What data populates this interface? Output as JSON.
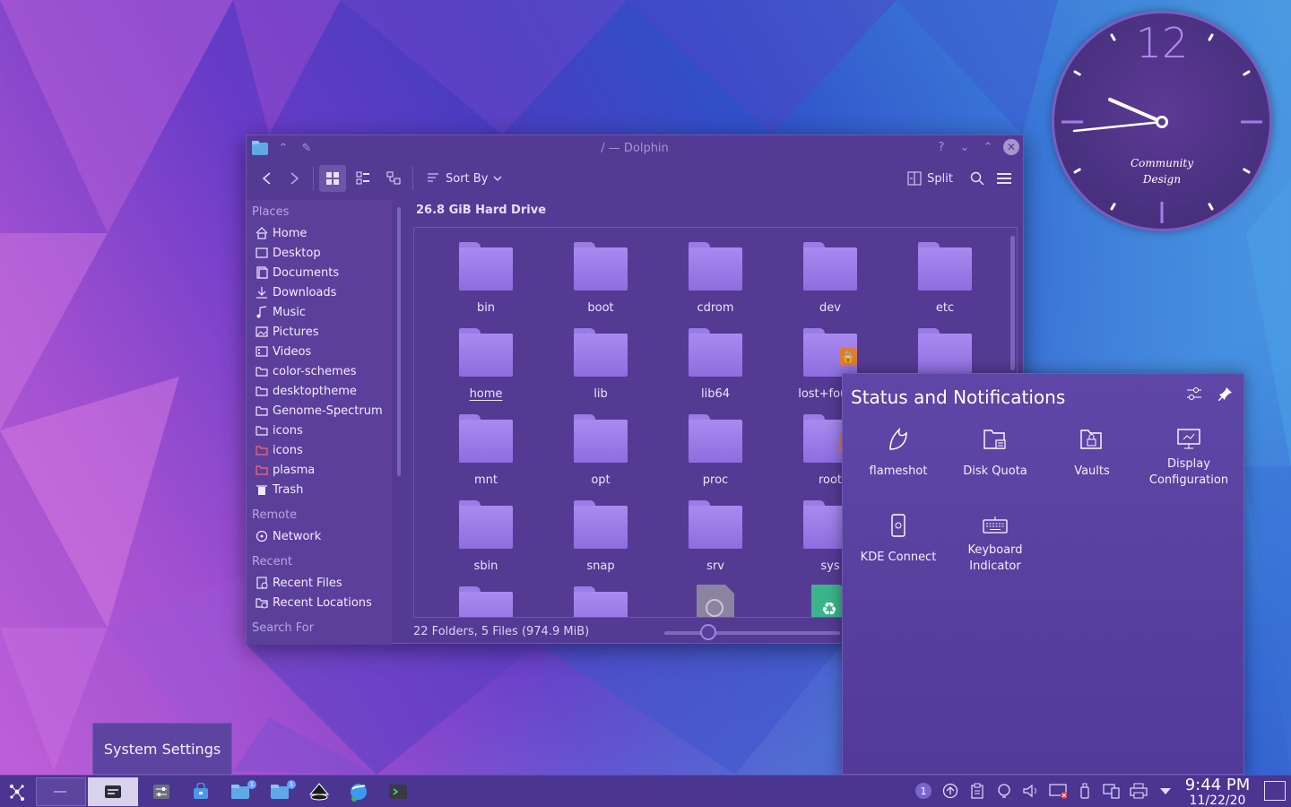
{
  "clock_widget": {
    "twelve": "12",
    "brand_line1": "Community",
    "brand_line2": "Design"
  },
  "dolphin": {
    "title": "/ — Dolphin",
    "toolbar": {
      "sort_by": "Sort By",
      "split": "Split"
    },
    "places": {
      "section_places": "Places",
      "items": [
        {
          "label": "Home",
          "icon": "home-icon"
        },
        {
          "label": "Desktop",
          "icon": "desktop-icon"
        },
        {
          "label": "Documents",
          "icon": "documents-icon"
        },
        {
          "label": "Downloads",
          "icon": "downloads-icon"
        },
        {
          "label": "Music",
          "icon": "music-icon"
        },
        {
          "label": "Pictures",
          "icon": "pictures-icon"
        },
        {
          "label": "Videos",
          "icon": "videos-icon"
        },
        {
          "label": "color-schemes",
          "icon": "folder-icon"
        },
        {
          "label": "desktoptheme",
          "icon": "folder-icon"
        },
        {
          "label": "Genome-Spectrum",
          "icon": "folder-icon"
        },
        {
          "label": "icons",
          "icon": "folder-icon"
        },
        {
          "label": "icons",
          "icon": "folder-red-icon"
        },
        {
          "label": "plasma",
          "icon": "folder-red-icon"
        },
        {
          "label": "Trash",
          "icon": "trash-icon"
        }
      ],
      "section_remote": "Remote",
      "remote_items": [
        {
          "label": "Network",
          "icon": "network-icon"
        }
      ],
      "section_recent": "Recent",
      "recent_items": [
        {
          "label": "Recent Files",
          "icon": "recent-files-icon"
        },
        {
          "label": "Recent Locations",
          "icon": "recent-locations-icon"
        }
      ],
      "section_search": "Search For"
    },
    "drive_title": "26.8 GiB Hard Drive",
    "files": [
      {
        "name": "bin"
      },
      {
        "name": "boot"
      },
      {
        "name": "cdrom"
      },
      {
        "name": "dev"
      },
      {
        "name": "etc"
      },
      {
        "name": "home"
      },
      {
        "name": "lib"
      },
      {
        "name": "lib64"
      },
      {
        "name": "lost+found"
      },
      {
        "name": ""
      },
      {
        "name": "mnt"
      },
      {
        "name": "opt"
      },
      {
        "name": "proc"
      },
      {
        "name": "root"
      },
      {
        "name": ""
      },
      {
        "name": "sbin"
      },
      {
        "name": "snap"
      },
      {
        "name": "srv"
      },
      {
        "name": "sys"
      },
      {
        "name": ""
      }
    ],
    "status": "22 Folders, 5 Files (974.9 MiB)",
    "zoom_level": 0.25
  },
  "notifications": {
    "title": "Status and Notifications",
    "tiles": [
      {
        "label": "flameshot",
        "icon": "flameshot-icon"
      },
      {
        "label": "Disk Quota",
        "icon": "disk-quota-icon"
      },
      {
        "label": "Vaults",
        "icon": "vaults-icon"
      },
      {
        "label": "Display Configuration",
        "icon": "display-configuration-icon"
      },
      {
        "label": "KDE Connect",
        "icon": "kde-connect-icon"
      },
      {
        "label": "Keyboard Indicator",
        "icon": "keyboard-indicator-icon"
      }
    ]
  },
  "tooltip": {
    "text": "System Settings"
  },
  "taskbar": {
    "time": "9:44 PM",
    "date": "11/22/20",
    "tray_badge": "1",
    "task_badge": "1"
  },
  "colors": {
    "accent": "#7a5cc0",
    "panel": "#4a3590",
    "window": "#553a94",
    "lock_badge": "#e07b34"
  }
}
